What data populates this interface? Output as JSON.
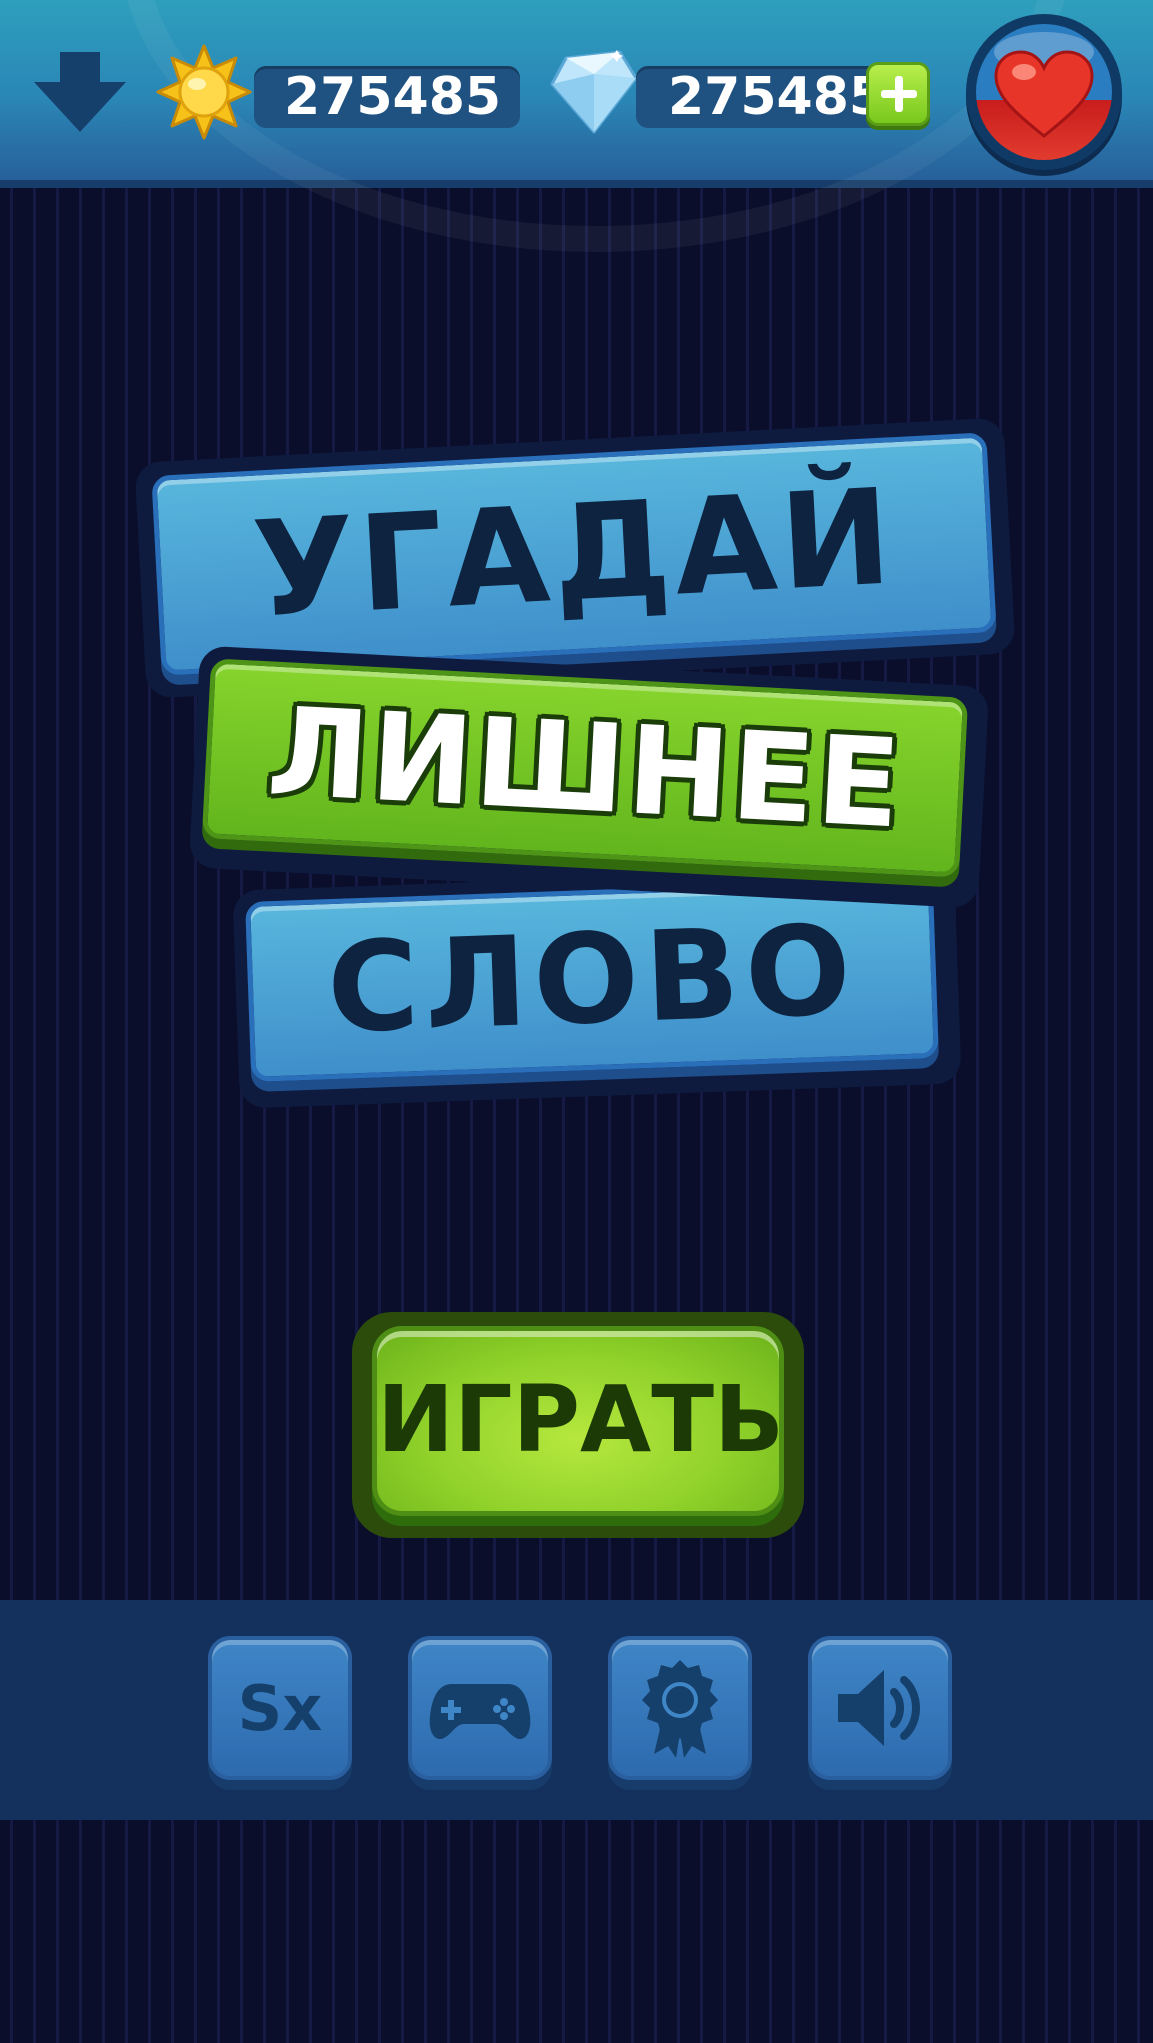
{
  "header": {
    "coins_value": "275485",
    "gems_value": "275485"
  },
  "title": {
    "line1": "УГАДАЙ",
    "line2": "ЛИШНЕЕ",
    "line3": "СЛОВО"
  },
  "play_button_label": "ИГРАТЬ",
  "toolbar": {
    "sx_label": "Sx",
    "icons": [
      "sx-icon",
      "gamepad-icon",
      "award-ribbon-icon",
      "speaker-icon"
    ]
  },
  "colors": {
    "accent_green": "#78c81e",
    "plate_blue": "#3f8fcb",
    "background": "#0b0f2e"
  }
}
